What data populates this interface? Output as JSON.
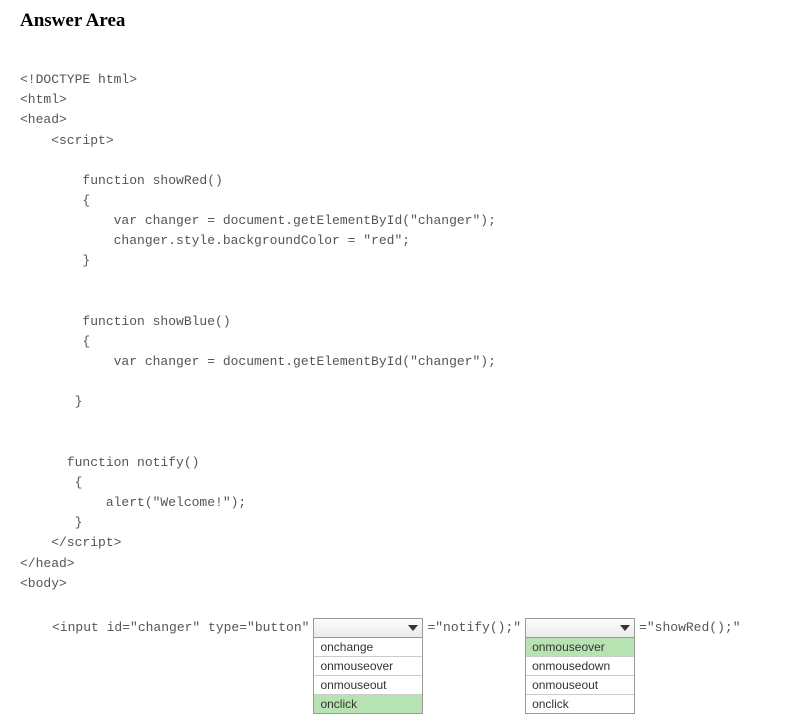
{
  "title": "Answer Area",
  "code_lines": {
    "l1": "<!DOCTYPE html>",
    "l2": "<html>",
    "l3": "<head>",
    "l4": "    <script>",
    "l5": "",
    "l6": "        function showRed()",
    "l7": "        {",
    "l8": "            var changer = document.getElementById(\"changer\");",
    "l9": "            changer.style.backgroundColor = \"red\";",
    "l10": "        }",
    "l11": "",
    "l12": "",
    "l13": "        function showBlue()",
    "l14": "        {",
    "l15": "            var changer = document.getElementById(\"changer\");",
    "l16": "",
    "l17": "       }",
    "l18": "",
    "l19": "",
    "l20": "      function notify()",
    "l21": "       {",
    "l22": "           alert(\"Welcome!\");",
    "l23": "       }",
    "l24": "    </script>",
    "l25": "</head>",
    "l26": "<body>",
    "l27": ""
  },
  "input_prefix": "<input id=\"changer\" type=\"button\"  ",
  "notify_eq": " =\"notify();\"  ",
  "showred_eq": " =\"showRed();\"",
  "dropdown1": {
    "options": [
      "onchange",
      "onmouseover",
      "onmouseout",
      "onclick"
    ],
    "selected_index": 3
  },
  "dropdown2": {
    "options": [
      "onmouseover",
      "onmousedown",
      "onmouseout",
      "onclick"
    ],
    "selected_index": 0
  }
}
